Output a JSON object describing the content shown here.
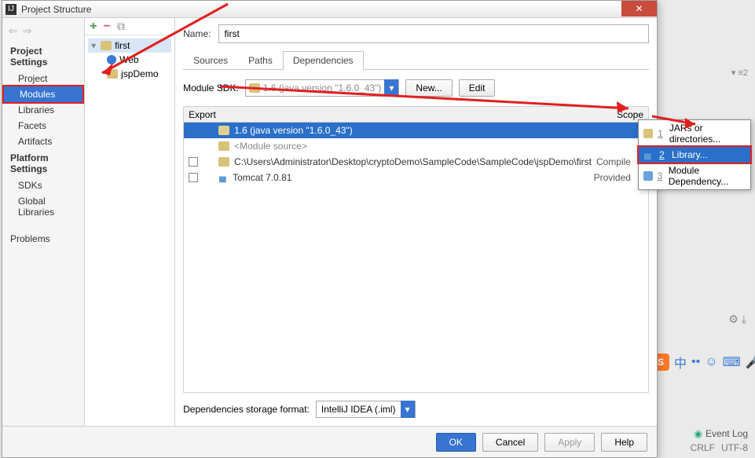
{
  "window": {
    "title": "Project Structure"
  },
  "leftnav": {
    "section1": "Project Settings",
    "items1": [
      "Project",
      "Modules",
      "Libraries",
      "Facets",
      "Artifacts"
    ],
    "section2": "Platform Settings",
    "items2": [
      "SDKs",
      "Global Libraries"
    ],
    "section3": "Problems"
  },
  "tree": {
    "root": "first",
    "children": [
      "Web",
      "jspDemo"
    ]
  },
  "main": {
    "name_label": "Name:",
    "name_value": "first",
    "tabs": [
      "Sources",
      "Paths",
      "Dependencies"
    ],
    "sdk_label": "Module SDK:",
    "sdk_value": "1.6 (java version \"1.6.0_43\")",
    "sdk_new": "New...",
    "sdk_edit": "Edit",
    "dep_header": {
      "export": "Export",
      "scope": "Scope"
    },
    "dep_rows": [
      {
        "label": "1.6 (java version \"1.6.0_43\")",
        "scope": "",
        "selected": true
      },
      {
        "label": "<Module source>",
        "type": "module"
      },
      {
        "label": "C:\\Users\\Administrator\\Desktop\\cryptoDemo\\SampleCode\\SampleCode\\jspDemo\\first",
        "scope": "Compile",
        "type": "folder",
        "check": true
      },
      {
        "label": "Tomcat 7.0.81",
        "scope": "Provided",
        "type": "lib",
        "check": true
      }
    ],
    "storage_label": "Dependencies storage format:",
    "storage_value": "IntelliJ IDEA (.iml)"
  },
  "popup": {
    "items": [
      {
        "num": "1",
        "label": "JARs or directories...",
        "icon": "folder"
      },
      {
        "num": "2",
        "label": "Library...",
        "icon": "lib",
        "selected": true
      },
      {
        "num": "3",
        "label": "Module Dependency...",
        "icon": "mod"
      }
    ]
  },
  "buttons": {
    "ok": "OK",
    "cancel": "Cancel",
    "apply": "Apply",
    "help": "Help"
  },
  "statusbar": {
    "eventlog": "Event Log",
    "crlf": "CRLF",
    "enc": "UTF-8"
  },
  "rightside": {
    "tag": "▾ ≡2"
  }
}
